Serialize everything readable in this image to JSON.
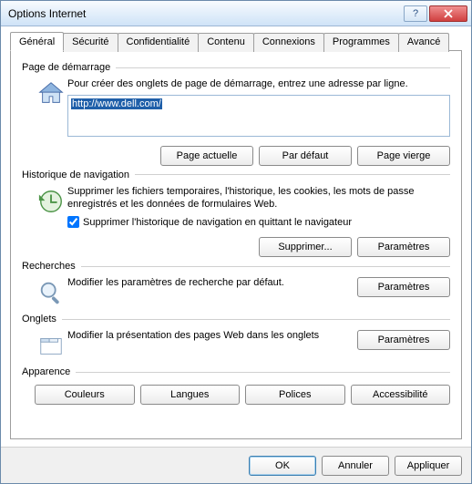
{
  "window": {
    "title": "Options Internet"
  },
  "tabs": {
    "items": [
      {
        "label": "Général"
      },
      {
        "label": "Sécurité"
      },
      {
        "label": "Confidentialité"
      },
      {
        "label": "Contenu"
      },
      {
        "label": "Connexions"
      },
      {
        "label": "Programmes"
      },
      {
        "label": "Avancé"
      }
    ],
    "active": 0
  },
  "homepage": {
    "title": "Page de démarrage",
    "desc": "Pour créer des onglets de page de démarrage, entrez une adresse par ligne.",
    "url": "http://www.dell.com/",
    "buttons": {
      "current": "Page actuelle",
      "default": "Par défaut",
      "blank": "Page vierge"
    }
  },
  "history": {
    "title": "Historique de navigation",
    "desc": "Supprimer les fichiers temporaires, l'historique, les cookies, les mots de passe enregistrés et les données de formulaires Web.",
    "delete_on_exit_label": "Supprimer l'historique de navigation en quittant le navigateur",
    "delete_on_exit_checked": true,
    "buttons": {
      "delete": "Supprimer...",
      "settings": "Paramètres"
    }
  },
  "search": {
    "title": "Recherches",
    "desc": "Modifier les paramètres de recherche par défaut.",
    "buttons": {
      "settings": "Paramètres"
    }
  },
  "tabs_section": {
    "title": "Onglets",
    "desc": "Modifier la présentation des pages Web dans les onglets",
    "buttons": {
      "settings": "Paramètres"
    }
  },
  "appearance": {
    "title": "Apparence",
    "buttons": {
      "colors": "Couleurs",
      "languages": "Langues",
      "fonts": "Polices",
      "accessibility": "Accessibilité"
    }
  },
  "footer": {
    "ok": "OK",
    "cancel": "Annuler",
    "apply": "Appliquer"
  }
}
